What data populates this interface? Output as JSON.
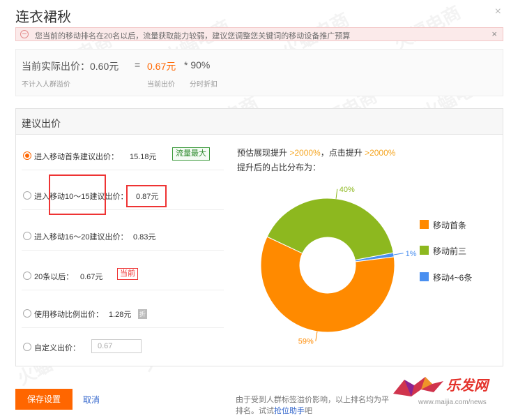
{
  "window": {
    "title": "连衣裙秋",
    "close_glyph": "×"
  },
  "notice": {
    "text": "您当前的移动排名在20名以后，流量获取能力较弱，建议您调整您关键词的移动设备推广预算",
    "close_glyph": "×"
  },
  "price": {
    "actual_label": "当前实际出价：0.60元",
    "equals": "=",
    "current_bid": "0.67元",
    "multiplier": "* 90%",
    "sub_left": "不计入人群溢价",
    "sub_mid": "当前出价",
    "sub_right": "分时折扣"
  },
  "suggest": {
    "header": "建议出价",
    "options": [
      {
        "label": "进入移动首条建议出价：",
        "value": "15.18元",
        "tag": "流量最大",
        "checked": true
      },
      {
        "label": "进入移动10～15建议出价：",
        "value": "0.87元",
        "checked": false
      },
      {
        "label": "进入移动16～20建议出价：",
        "value": "0.83元",
        "checked": false
      },
      {
        "label": "20条以后：",
        "value": "0.67元",
        "tag": "当前",
        "checked": false
      },
      {
        "label": "使用移动比例出价：",
        "value": "1.28元",
        "tag": "折",
        "checked": false
      },
      {
        "label": "自定义出价：",
        "input_value": "0.67",
        "checked": false
      }
    ]
  },
  "chart_intro": {
    "line1_pre": "预估展现提升 ",
    "line1_hl1": ">2000%",
    "line1_mid": "，点击提升 ",
    "line1_hl2": ">2000%",
    "line2": "提升后的占比分布为："
  },
  "chart_data": {
    "type": "pie",
    "donut": true,
    "categories": [
      "移动首条",
      "移动前三",
      "移动4~6条"
    ],
    "values": [
      59,
      40,
      1
    ],
    "labels": [
      "59%",
      "40%",
      "1%"
    ],
    "colors": [
      "#ff8a00",
      "#8db81f",
      "#4a8ff0"
    ],
    "legend_position": "right"
  },
  "footer": {
    "save_label": "保存设置",
    "cancel_label": "取消",
    "note_line1": "由于受到人群标签溢价影响，以上排名均为平",
    "note_line2_pre": "排名。试试",
    "note_link": "抢位助手",
    "note_line2_post": "吧"
  },
  "watermark": {
    "text": "火蝠电商"
  },
  "branding": {
    "logo_text": "乐发网",
    "site": "www.maijia.com/news"
  }
}
